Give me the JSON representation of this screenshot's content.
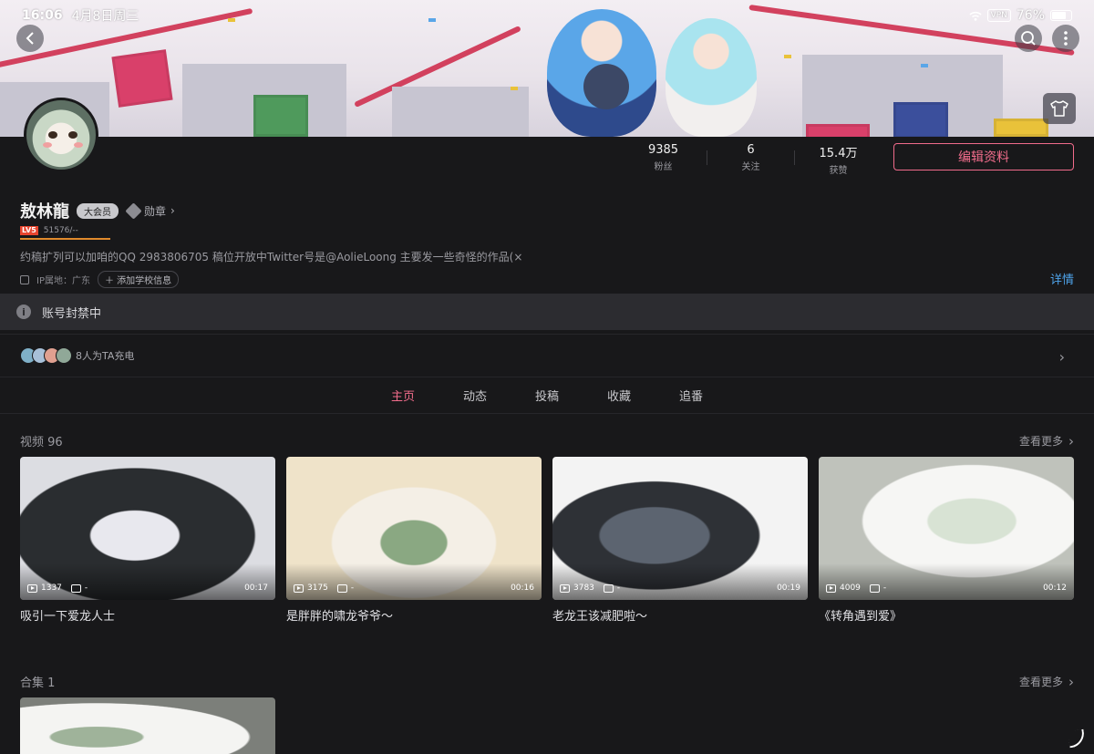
{
  "status": {
    "time": "16:06",
    "date": "4月8日周三",
    "vpn": "VPN",
    "battery": "76%"
  },
  "icons": {
    "back": "back-arrow-icon",
    "search": "search-icon",
    "more": "more-vertical-icon",
    "skin": "tshirt-icon"
  },
  "profile": {
    "username": "敖林龍",
    "vip": "大会员",
    "medal_label": "勋章",
    "level": "LV5",
    "exp": "51576/--",
    "bio": "约稿扩列可以加咱的QQ 2983806705 稿位开放中Twitter号是@AolieLoong 主要发一些奇怪的作品(×",
    "ip": "IP属地：广东",
    "school_btn": "添加学校信息",
    "detail": "详情"
  },
  "stats": [
    {
      "value": "9385",
      "label": "粉丝"
    },
    {
      "value": "6",
      "label": "关注"
    },
    {
      "value": "15.4万",
      "label": "获赞"
    }
  ],
  "edit_button": "编辑资料",
  "ban_notice": "账号封禁中",
  "charge": {
    "text": "8人为TA充电"
  },
  "tabs": [
    "主页",
    "动态",
    "投稿",
    "收藏",
    "追番"
  ],
  "active_tab": "主页",
  "videos_section": {
    "title": "视频 96",
    "more": "查看更多"
  },
  "videos": [
    {
      "title": "吸引一下爱龙人士",
      "views": "1337",
      "danmaku": "-",
      "duration": "00:17"
    },
    {
      "title": "是胖胖的啸龙爷爷～",
      "views": "3175",
      "danmaku": "-",
      "duration": "00:16"
    },
    {
      "title": "老龙王该减肥啦～",
      "views": "3783",
      "danmaku": "-",
      "duration": "00:19"
    },
    {
      "title": "《转角遇到爱》",
      "views": "4009",
      "danmaku": "-",
      "duration": "00:12"
    }
  ],
  "collections_section": {
    "title": "合集 1",
    "more": "查看更多"
  },
  "colors": {
    "accent": "#f26d8c",
    "link": "#4ea3ea",
    "background": "#18181a"
  }
}
